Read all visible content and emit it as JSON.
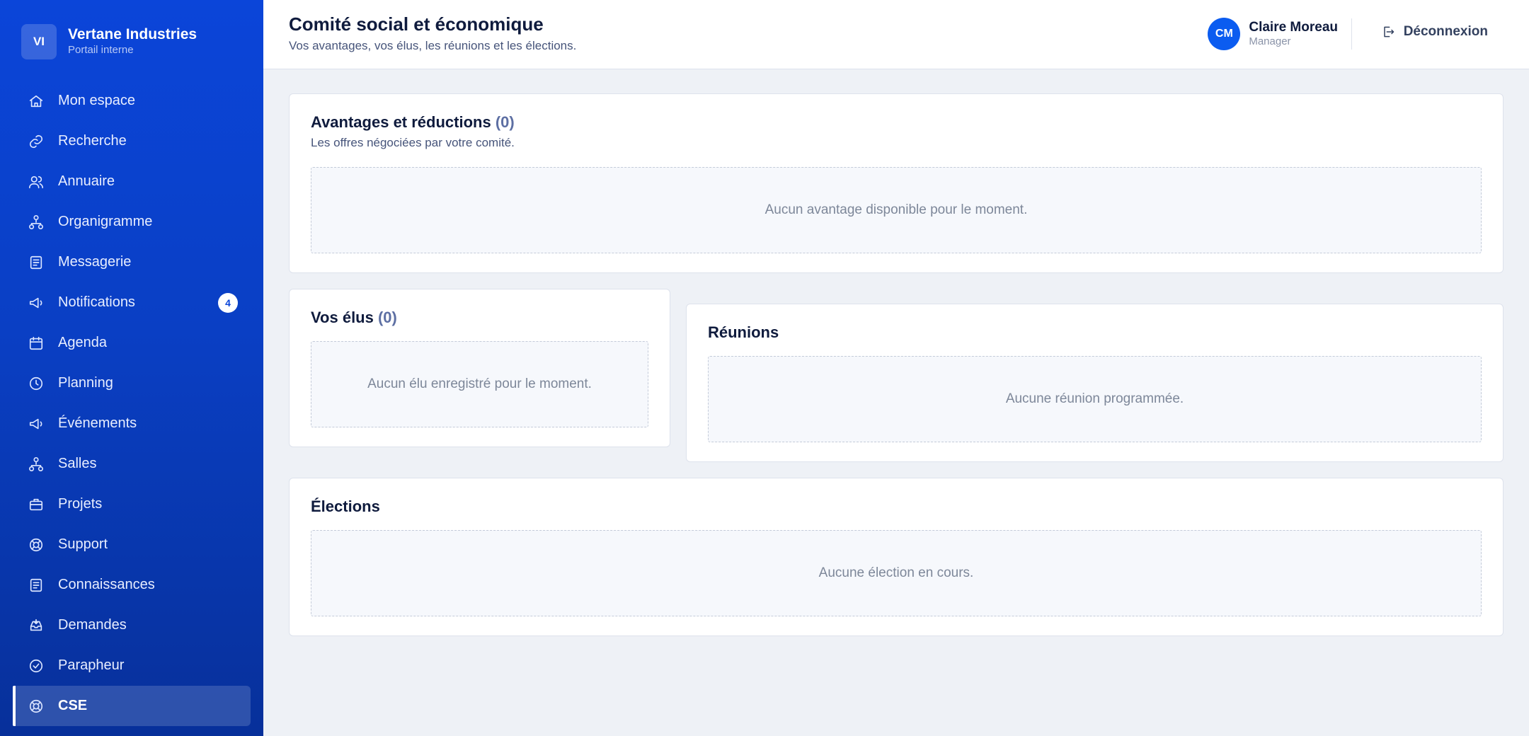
{
  "brand": {
    "logo": "VI",
    "name": "Vertane Industries",
    "subtitle": "Portail interne"
  },
  "sidebar": {
    "items": [
      {
        "label": "Mon espace",
        "icon": "home-icon"
      },
      {
        "label": "Recherche",
        "icon": "link-icon"
      },
      {
        "label": "Annuaire",
        "icon": "users-icon"
      },
      {
        "label": "Organigramme",
        "icon": "org-chart-icon"
      },
      {
        "label": "Messagerie",
        "icon": "document-icon"
      },
      {
        "label": "Notifications",
        "icon": "megaphone-icon",
        "badge": "4"
      },
      {
        "label": "Agenda",
        "icon": "calendar-icon"
      },
      {
        "label": "Planning",
        "icon": "clock-icon"
      },
      {
        "label": "Événements",
        "icon": "megaphone-icon"
      },
      {
        "label": "Salles",
        "icon": "org-chart-icon"
      },
      {
        "label": "Projets",
        "icon": "briefcase-icon"
      },
      {
        "label": "Support",
        "icon": "lifebuoy-icon"
      },
      {
        "label": "Connaissances",
        "icon": "document-icon"
      },
      {
        "label": "Demandes",
        "icon": "inbox-icon"
      },
      {
        "label": "Parapheur",
        "icon": "check-circle-icon"
      },
      {
        "label": "CSE",
        "icon": "lifebuoy-icon",
        "active": true
      }
    ]
  },
  "header": {
    "title": "Comité social et économique",
    "subtitle": "Vos avantages, vos élus, les réunions et les élections.",
    "user": {
      "initials": "CM",
      "name": "Claire Moreau",
      "role": "Manager"
    },
    "logout_label": "Déconnexion"
  },
  "main": {
    "advantages": {
      "title": "Avantages et réductions",
      "count": "(0)",
      "subtitle": "Les offres négociées par votre comité.",
      "empty": "Aucun avantage disponible pour le moment."
    },
    "elus": {
      "title": "Vos élus",
      "count": "(0)",
      "empty": "Aucun élu enregistré pour le moment."
    },
    "reunions": {
      "title": "Réunions",
      "empty": "Aucune réunion programmée."
    },
    "elections": {
      "title": "Élections",
      "empty": "Aucune élection en cours."
    }
  },
  "colors": {
    "sidebar": "#0b45d9",
    "accent": "#0b5cf0",
    "background": "#eef1f6"
  }
}
